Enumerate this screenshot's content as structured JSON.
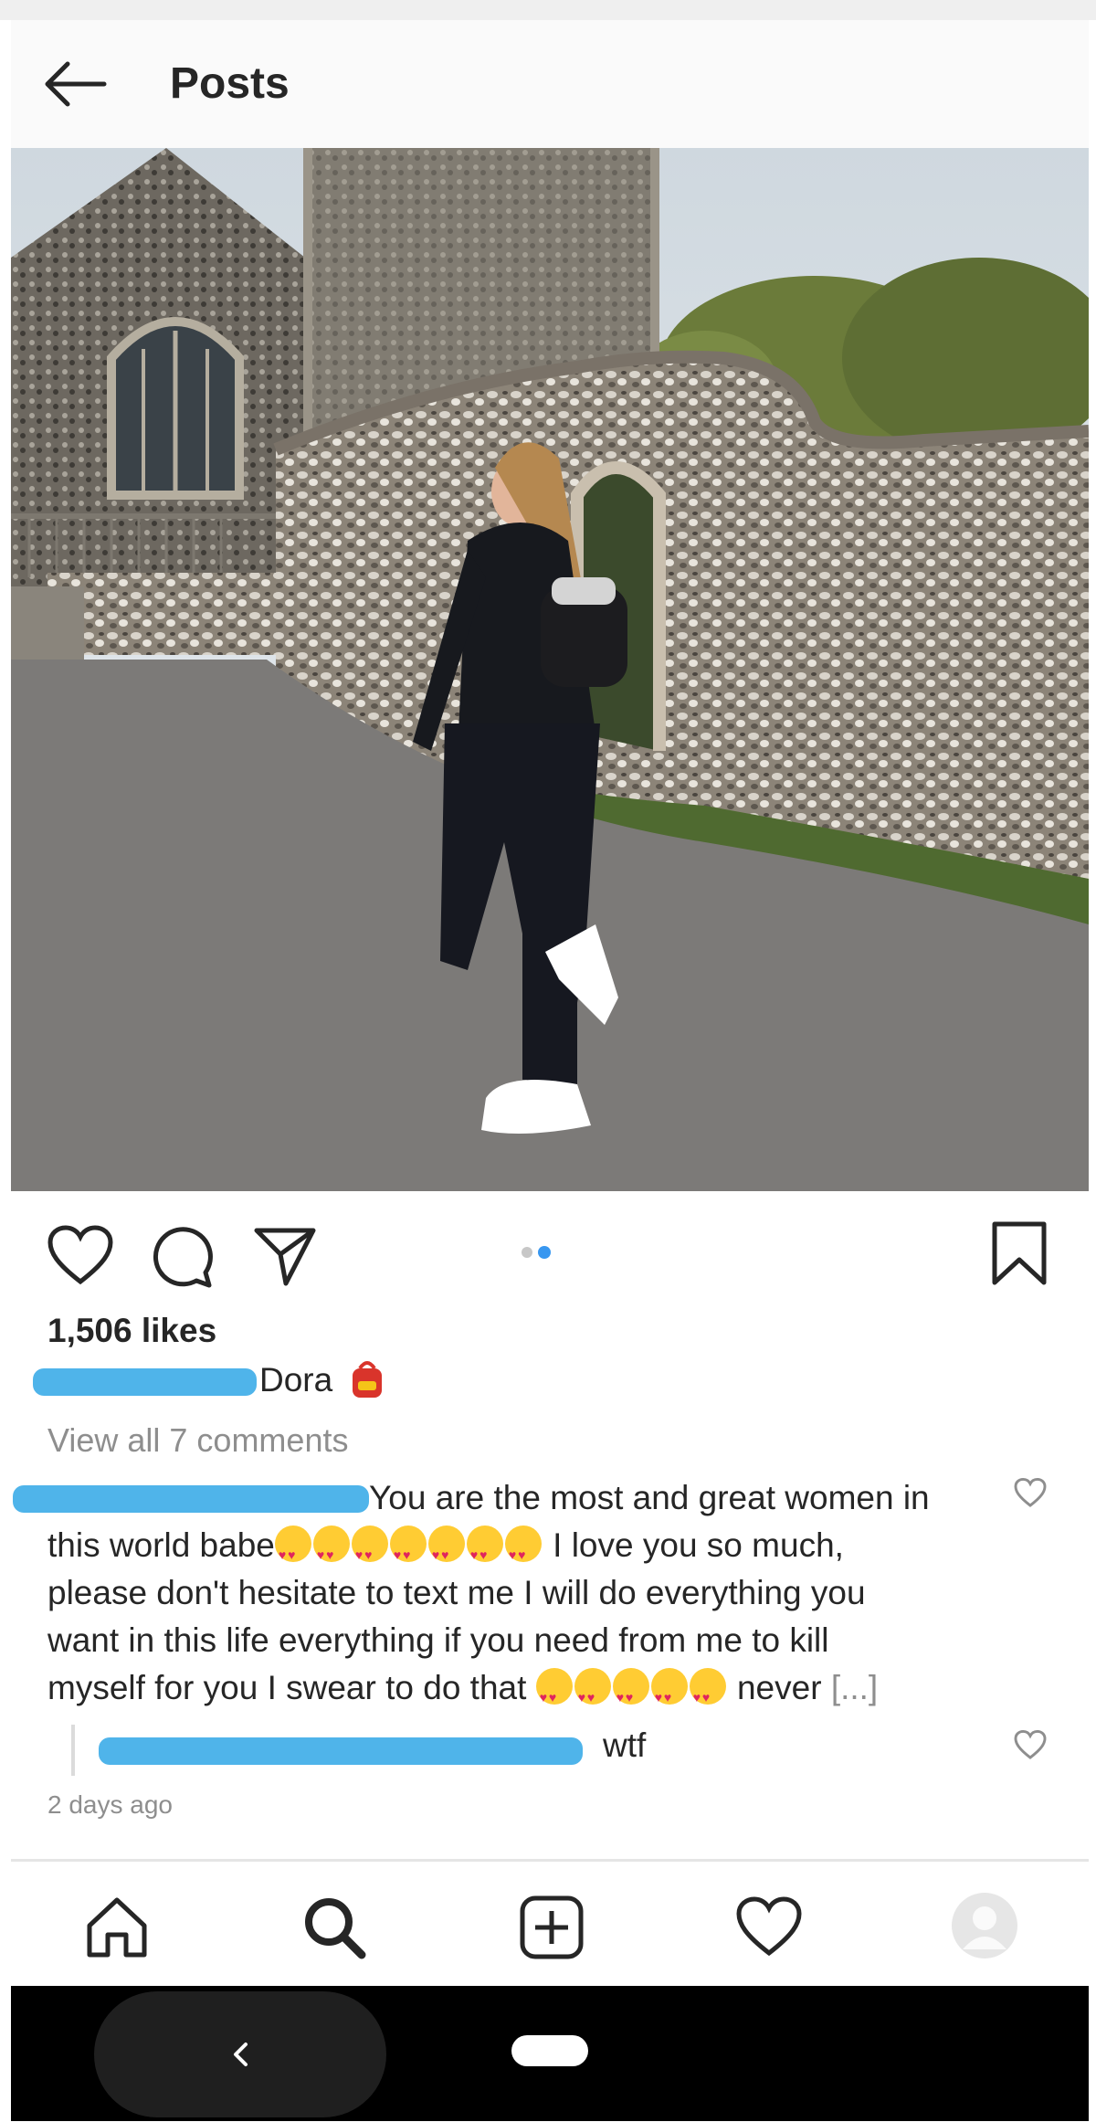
{
  "header": {
    "title": "Posts"
  },
  "post": {
    "likes": "1,506 likes",
    "caption_name": "Dora",
    "caption_emoji": "school-backpack-emoji",
    "view_all": "View all 7 comments",
    "carousel_dots": 2,
    "carousel_active": 2
  },
  "comment": {
    "line1": "You are the most and great women in",
    "line2_start": "this world babe",
    "line2_end": "I love you so much,",
    "line3": "please don't hesitate to text me I will do everything you",
    "line4": "want in this life everything if you need from me to kill",
    "line5_start": "myself for you I swear to do that",
    "line5_end": "never",
    "more": "[...]"
  },
  "reply": {
    "text": "wtf"
  },
  "timestamp": "2 days ago",
  "colors": {
    "redaction": "#4fb4ea",
    "accent": "#3897f0",
    "muted": "#8e8e8e"
  },
  "icons": [
    "back-arrow-icon",
    "heart-icon",
    "comment-icon",
    "share-icon",
    "bookmark-icon",
    "home-icon",
    "search-icon",
    "add-post-icon",
    "activity-heart-icon",
    "profile-avatar-icon"
  ]
}
